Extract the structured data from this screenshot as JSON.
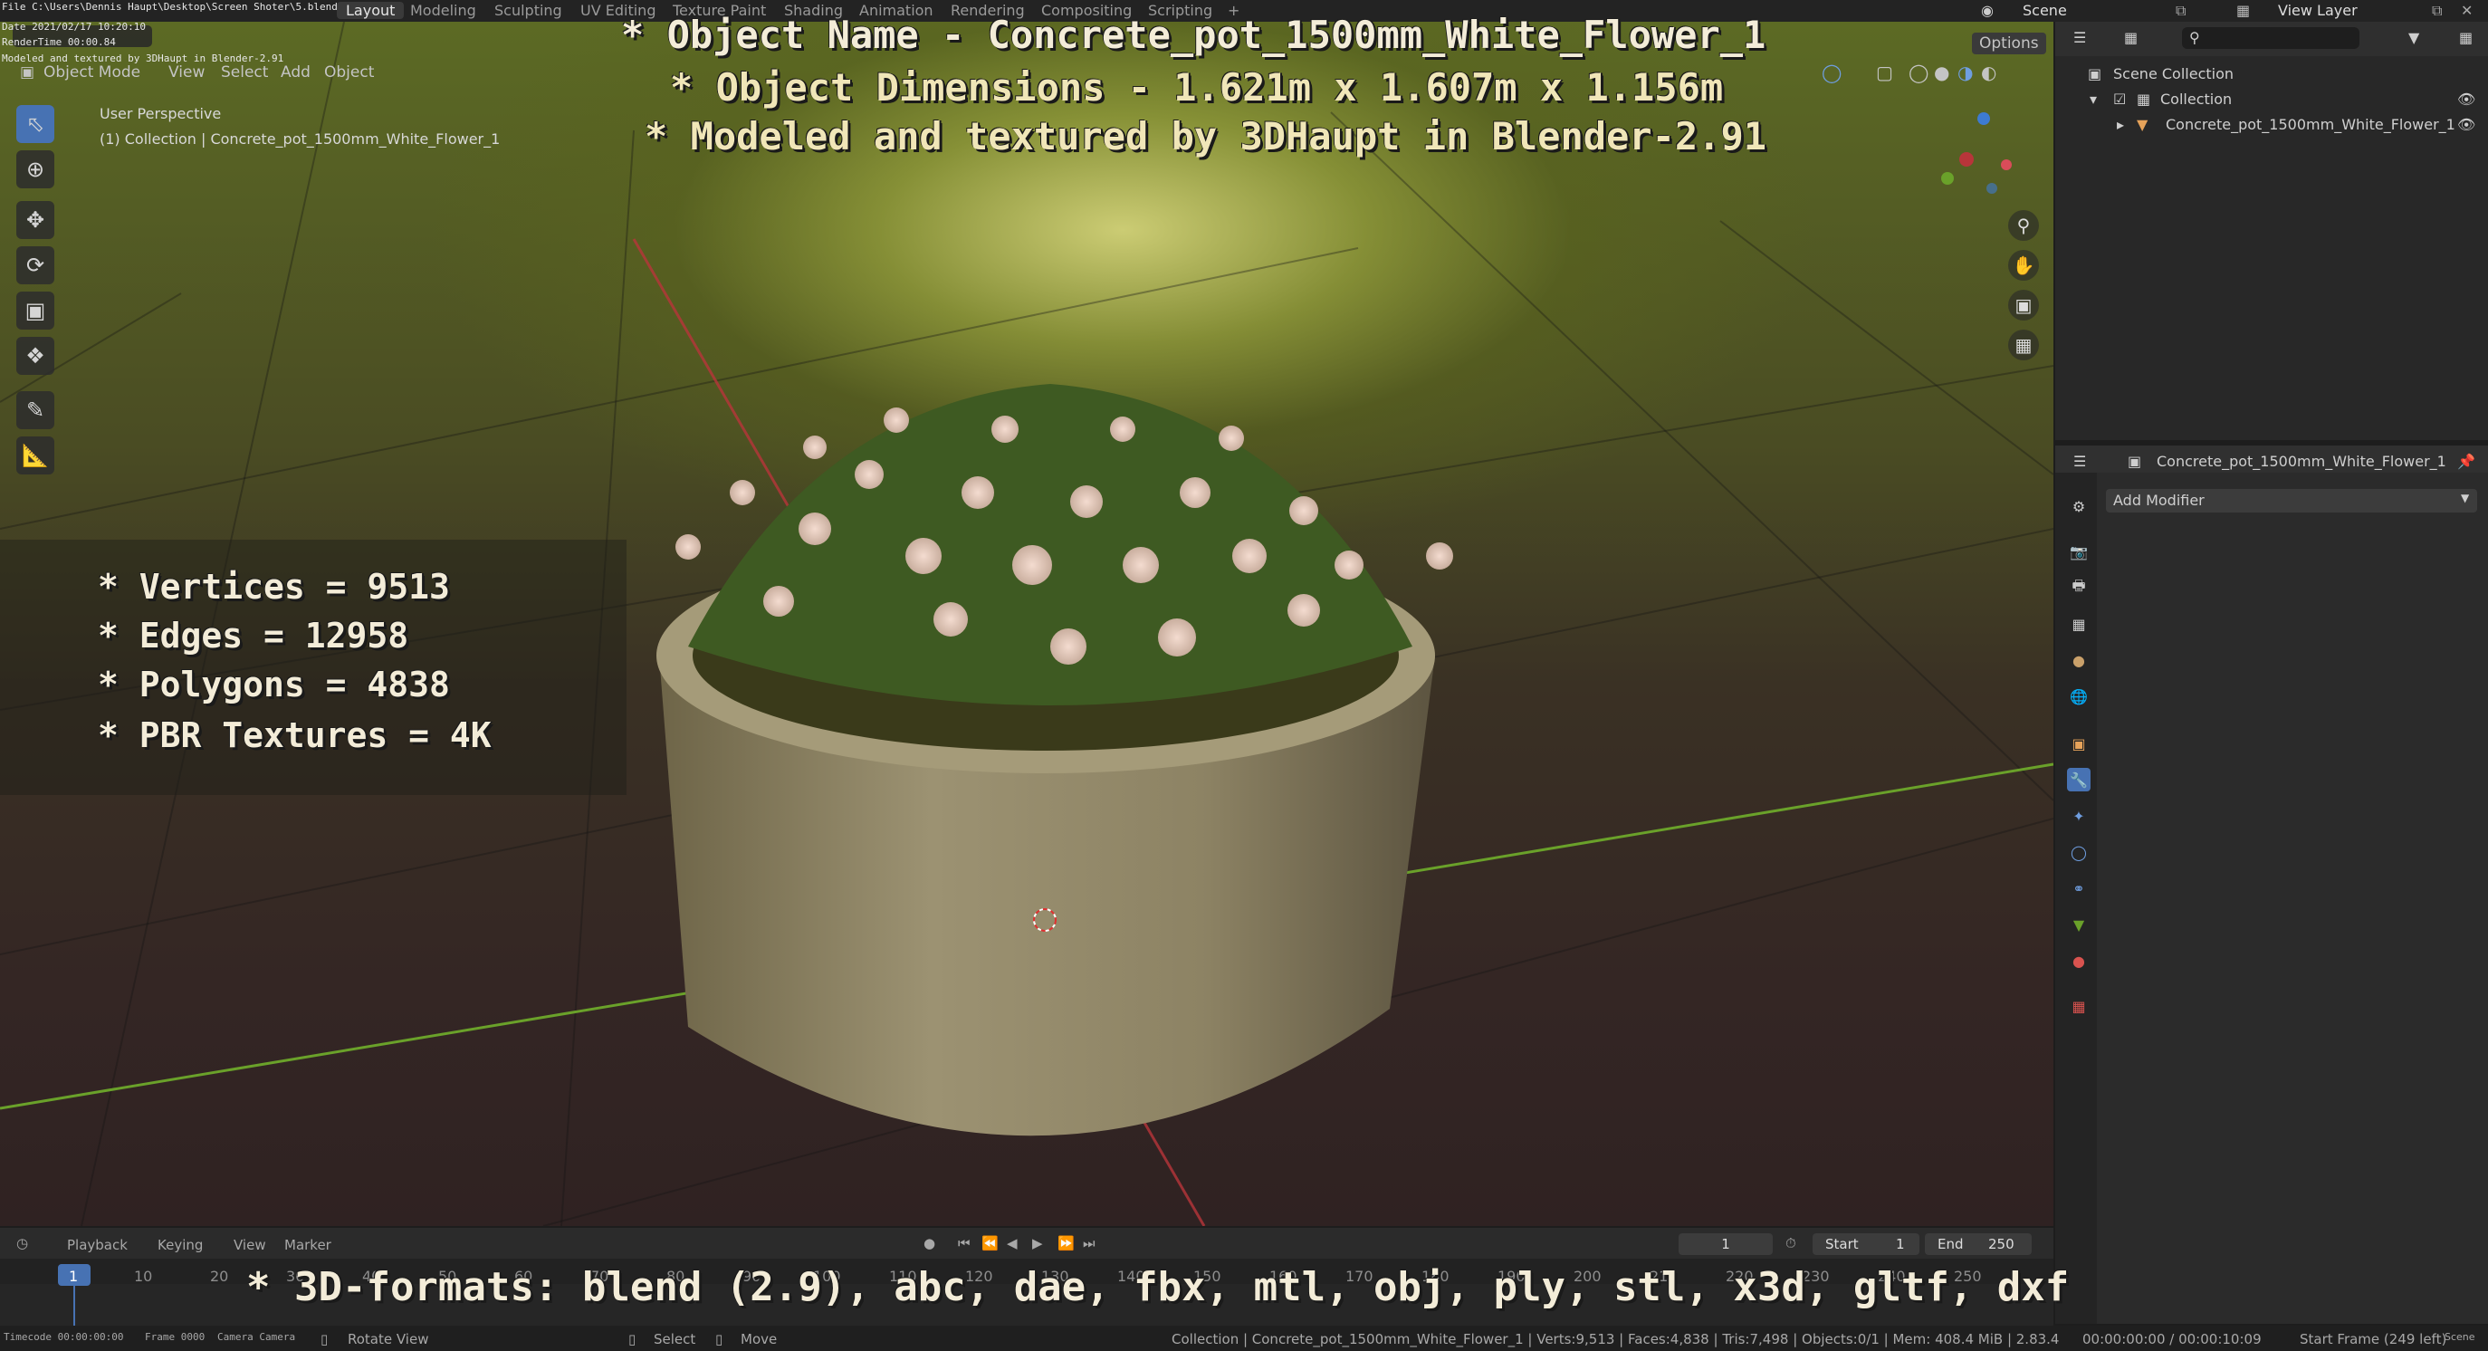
{
  "topbar": {
    "file_path": "File C:\\Users\\Dennis Haupt\\Desktop\\Screen Shoter\\5.blend",
    "date": "Date 2021/02/17 10:20:10",
    "render_time": "RenderTime 00:00.84",
    "modeled": "Modeled and textured by 3DHaupt in Blender-2.91",
    "tabs": [
      "Layout",
      "Modeling",
      "Sculpting",
      "UV Editing",
      "Texture Paint",
      "Shading",
      "Animation",
      "Rendering",
      "Compositing",
      "Scripting"
    ],
    "add_tab": "+",
    "scene": "Scene",
    "view_layer": "View Layer"
  },
  "viewport_header": {
    "mode": "Object Mode",
    "menus": [
      "View",
      "Select",
      "Add",
      "Object"
    ],
    "options": "Options",
    "perspective": "User Perspective",
    "collection_line": "(1) Collection | Concrete_pot_1500mm_White_Flower_1"
  },
  "overlay": {
    "object_name": "* Object Name - Concrete_pot_1500mm_White_Flower_1",
    "dimensions": "* Object Dimensions -  1.621m x 1.607m x 1.156m",
    "credit": "* Modeled and textured by 3DHaupt in Blender-2.91",
    "stats": [
      "* Vertices = 9513",
      "* Edges = 12958",
      "* Polygons = 4838",
      "* PBR Textures = 4K"
    ],
    "formats": "* 3D-formats: blend (2.9), abc, dae, fbx, mtl, obj, ply, stl, x3d, gltf, dxf"
  },
  "outliner": {
    "scene_collection": "Scene Collection",
    "collection": "Collection",
    "object": "Concrete_pot_1500mm_White_Flower_1"
  },
  "properties": {
    "object": "Concrete_pot_1500mm_White_Flower_1",
    "add_modifier": "Add Modifier"
  },
  "timeline": {
    "menus": [
      "Playback",
      "Keying",
      "View",
      "Marker"
    ],
    "current_frame": "1",
    "start_label": "Start",
    "start": "1",
    "end_label": "End",
    "end": "250",
    "ruler": [
      "1",
      "10",
      "20",
      "30",
      "40",
      "50",
      "60",
      "70",
      "80",
      "90",
      "100",
      "110",
      "120",
      "130",
      "140",
      "150",
      "160",
      "170",
      "180",
      "190",
      "200",
      "210",
      "220",
      "230",
      "240",
      "250"
    ]
  },
  "statusbar": {
    "timecode": "Timecode 00:00:00:00",
    "frame": "Frame 0000",
    "camera": "Camera Camera",
    "rotate": "Rotate View",
    "select": "Select",
    "move": "Move",
    "stats": "Collection | Concrete_pot_1500mm_White_Flower_1 | Verts:9,513 | Faces:4,838 | Tris:7,498 | Objects:0/1 | Mem: 408.4 MiB | 2.83.4",
    "time": "00:00:00:00 / 00:00:10:09",
    "start_frame": "Start Frame (249 left)",
    "scene": "Scene"
  },
  "colors": {
    "accent": "#4772b3",
    "frame_marker": "#4772b3",
    "axis_red": "#b8353a",
    "axis_green": "#6aa12a"
  }
}
